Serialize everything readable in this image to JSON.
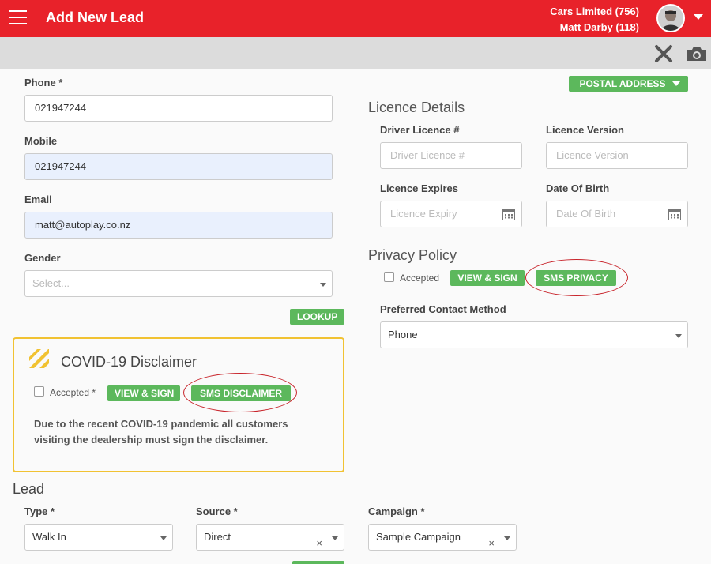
{
  "header": {
    "title": "Add New Lead",
    "company": "Cars Limited (756)",
    "user": "Matt Darby (118)"
  },
  "colors": {
    "brand": "#e8222a",
    "button": "#5cb85c",
    "covid_border": "#f1c232",
    "highlight": "#c8242b"
  },
  "icons": {
    "menu": "hamburger-icon",
    "close": "close-icon",
    "camera": "camera-icon",
    "calendar": "calendar-icon",
    "warning": "hazard-stripes-icon"
  },
  "contact": {
    "phone_label": "Phone *",
    "phone_value": "021947244",
    "mobile_label": "Mobile",
    "mobile_value": "021947244",
    "email_label": "Email",
    "email_value": "matt@autoplay.co.nz",
    "gender_label": "Gender",
    "gender_placeholder": "Select...",
    "lookup_label": "LOOKUP"
  },
  "postal": {
    "label": "POSTAL ADDRESS"
  },
  "licence": {
    "title": "Licence Details",
    "driver_label": "Driver Licence #",
    "driver_placeholder": "Driver Licence #",
    "version_label": "Licence Version",
    "version_placeholder": "Licence Version",
    "expires_label": "Licence Expires",
    "expires_placeholder": "Licence Expiry",
    "dob_label": "Date Of Birth",
    "dob_placeholder": "Date Of Birth"
  },
  "privacy": {
    "title": "Privacy Policy",
    "accepted_label": "Accepted",
    "view_sign": "VIEW & SIGN",
    "sms_privacy": "SMS PRIVACY",
    "contact_method_label": "Preferred Contact Method",
    "contact_method_value": "Phone"
  },
  "covid": {
    "title": "COVID-19 Disclaimer",
    "accepted_label": "Accepted *",
    "view_sign": "VIEW & SIGN",
    "sms_disclaimer": "SMS DISCLAIMER",
    "text": "Due to the recent COVID-19 pandemic all customers visiting the dealership must sign the disclaimer."
  },
  "lead": {
    "title": "Lead",
    "type_label": "Type *",
    "type_value": "Walk In",
    "source_label": "Source *",
    "source_value": "Direct",
    "campaign_label": "Campaign *",
    "campaign_value": "Sample Campaign"
  }
}
